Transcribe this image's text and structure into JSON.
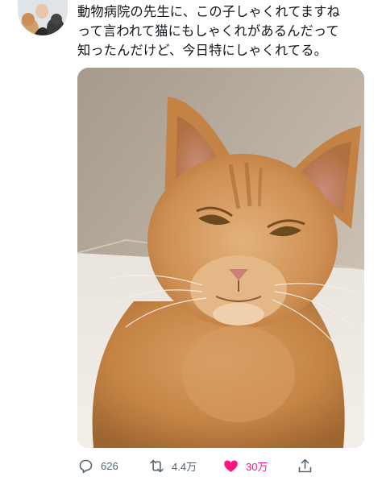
{
  "tweet": {
    "text": "動物病院の先生に、この子しゃくれてますね\nって言われて猫にもしゃくれがあるんだって\n知ったんだけど、今日特にしゃくれてる。"
  },
  "actions": {
    "reply": {
      "icon": "reply-icon",
      "count": "626"
    },
    "retweet": {
      "icon": "retweet-icon",
      "count": "4.4万"
    },
    "like": {
      "icon": "heart-icon",
      "count": "30万",
      "color": "#f91880",
      "active": true
    },
    "share": {
      "icon": "share-icon"
    }
  },
  "colors": {
    "text": "#0f1419",
    "secondary": "#536471",
    "like": "#f91880"
  }
}
